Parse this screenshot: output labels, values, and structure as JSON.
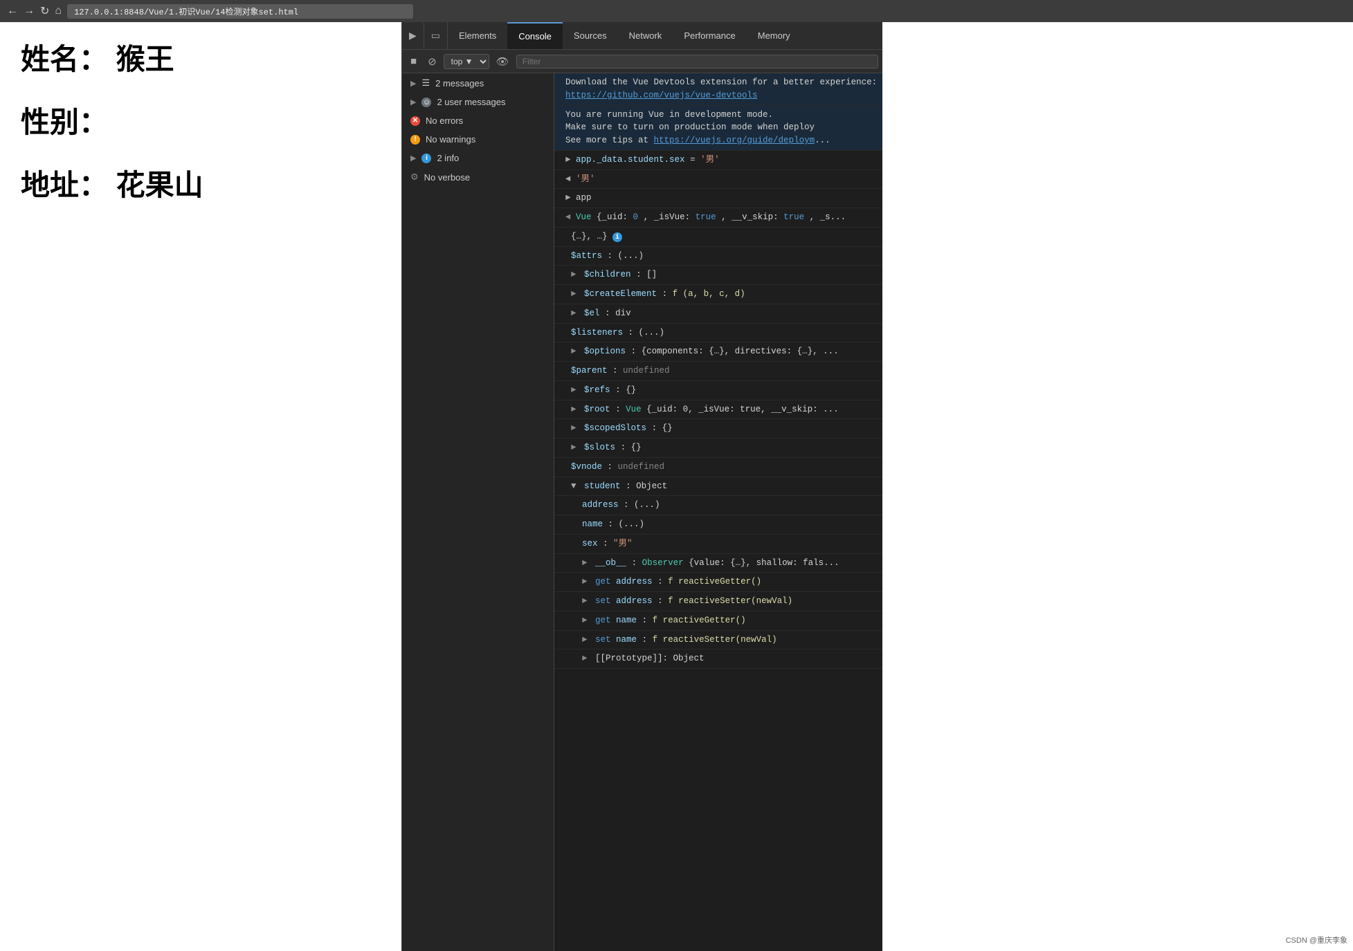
{
  "topbar": {
    "url": "127.0.0.1:8848/Vue/1.初识Vue/14检测对象set.html"
  },
  "page": {
    "line1": "姓名： 猴王",
    "line2": "性别：",
    "line3": "地址： 花果山"
  },
  "devtools": {
    "tabs": [
      "Elements",
      "Console",
      "Sources",
      "Network",
      "Performance",
      "Memory"
    ],
    "active_tab": "Console",
    "toolbar": {
      "context": "top",
      "filter_placeholder": "Filter"
    },
    "sidebar": {
      "items": [
        {
          "label": "2 messages",
          "type": "messages"
        },
        {
          "label": "2 user messages",
          "type": "user"
        },
        {
          "label": "No errors",
          "type": "error"
        },
        {
          "label": "No warnings",
          "type": "warning"
        },
        {
          "label": "2 info",
          "type": "info"
        },
        {
          "label": "No verbose",
          "type": "verbose"
        }
      ]
    },
    "console": {
      "entries": [
        {
          "type": "info",
          "text": "Download the Vue Devtools extension for a better experience:\nhttps://github.com/vuejs/vue-devtools"
        },
        {
          "type": "warn",
          "text": "You are running Vue in development mode.\nMake sure to turn on production mode when deploy\nSee more tips at https://vuejs.org/guide/deploym..."
        },
        {
          "type": "cmd",
          "text": "app._data.student.sex = '男'"
        },
        {
          "type": "result",
          "text": "'男'"
        },
        {
          "type": "log",
          "text": "app"
        },
        {
          "type": "vue-obj",
          "lines": [
            "Vue {_uid: 0, _isVue: true, __v_skip: true, _s...",
            "{…}, …} ℹ",
            "$attrs: (...)",
            "$children: []",
            "$createElement: f (a, b, c, d)",
            "$el: div",
            "$listeners: (...)",
            "$options: {components: {…}, directives: {…}, ...",
            "$parent: undefined",
            "$refs: {}",
            "$root: Vue {_uid: 0, _isVue: true, __v_skip: ...",
            "$scopedSlots: {}",
            "$slots: {}",
            "$vnode: undefined",
            "student: Object",
            "  address: (...)",
            "  name: (...)",
            "  sex: \"男\"",
            "  ▶ __ob__: Observer {value: {…}, shallow: fals...",
            "  ▶ get address: f reactiveGetter()",
            "  ▶ set address: f reactiveSetter(newVal)",
            "  ▶ get name: f reactiveGetter()",
            "  ▶ set name: f reactiveSetter(newVal)",
            "  ▶ [[Prototype]]: Object"
          ]
        }
      ]
    }
  },
  "watermark": "CSDN @重庆李象"
}
